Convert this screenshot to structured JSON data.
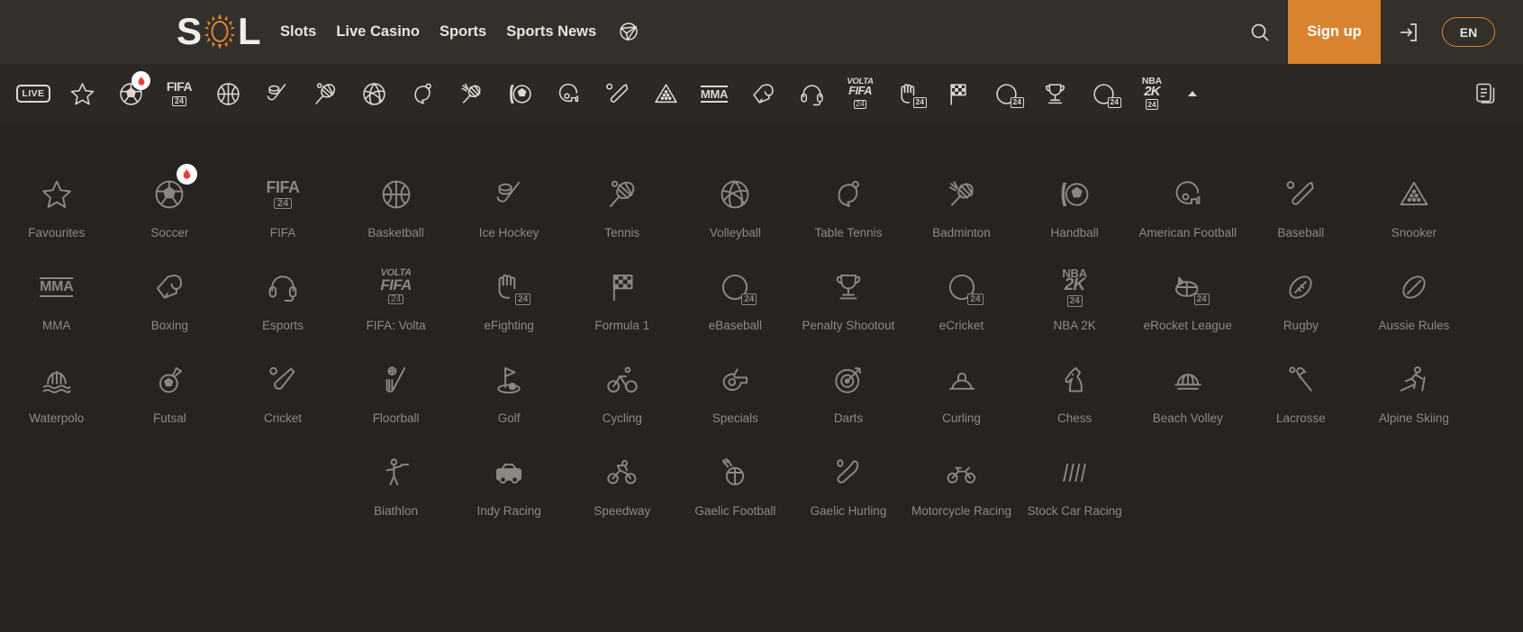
{
  "colors": {
    "page_bg": "#262320",
    "header_bg": "#332f2b",
    "toolbar_bg": "#2b2825",
    "accent_orange": "#d9832f",
    "icon_bright": "#ddd8cf",
    "icon_dim": "#8b8781",
    "label_text": "#8e8a84",
    "badge_flame_red": "#ef3b33"
  },
  "header": {
    "logo": {
      "text": "SOL",
      "letters": [
        "S",
        "O",
        "L"
      ],
      "icon": "sun-logo-icon"
    },
    "nav": [
      {
        "label": "Slots",
        "name": "nav-slots"
      },
      {
        "label": "Live Casino",
        "name": "nav-live-casino"
      },
      {
        "label": "Sports",
        "name": "nav-sports"
      },
      {
        "label": "Sports News",
        "name": "nav-sports-news"
      }
    ],
    "sports_news_icon": "paper-plane-globe-icon",
    "search_icon": "search-icon",
    "signup_label": "Sign up",
    "login_icon": "login-arrow-icon",
    "language_label": "EN"
  },
  "toolbar": {
    "collapse_icon": "chevron-up-icon",
    "bet_slip_icon": "bet-slip-documents-icon",
    "items": [
      {
        "name": "toolbar-live",
        "icon": "live-chip",
        "label": "LIVE"
      },
      {
        "name": "toolbar-favourites",
        "icon": "star-icon"
      },
      {
        "name": "toolbar-soccer",
        "icon": "soccer-ball-icon",
        "badge": "flame"
      },
      {
        "name": "toolbar-fifa",
        "icon": "fifa-24-badge",
        "label": "FIFA",
        "sub": "24"
      },
      {
        "name": "toolbar-basketball",
        "icon": "basketball-icon"
      },
      {
        "name": "toolbar-ice-hockey",
        "icon": "ice-hockey-icon"
      },
      {
        "name": "toolbar-tennis",
        "icon": "tennis-racket-icon"
      },
      {
        "name": "toolbar-volleyball",
        "icon": "volleyball-icon"
      },
      {
        "name": "toolbar-table-tennis",
        "icon": "table-tennis-icon"
      },
      {
        "name": "toolbar-badminton",
        "icon": "badminton-icon"
      },
      {
        "name": "toolbar-handball",
        "icon": "handball-icon"
      },
      {
        "name": "toolbar-american-football",
        "icon": "american-football-helmet-icon"
      },
      {
        "name": "toolbar-baseball",
        "icon": "baseball-bat-icon"
      },
      {
        "name": "toolbar-snooker",
        "icon": "snooker-triangle-icon"
      },
      {
        "name": "toolbar-mma",
        "icon": "mma-badge",
        "label": "MMA"
      },
      {
        "name": "toolbar-boxing",
        "icon": "boxing-glove-icon"
      },
      {
        "name": "toolbar-esports",
        "icon": "headset-icon"
      },
      {
        "name": "toolbar-fifa-volta",
        "icon": "volta-fifa-24-badge",
        "label": "VOLTA FIFA",
        "sub": "24"
      },
      {
        "name": "toolbar-efighting",
        "icon": "efighting-fist-icon",
        "sub": "24"
      },
      {
        "name": "toolbar-formula-1",
        "icon": "checkered-flag-icon"
      },
      {
        "name": "toolbar-ebaseball",
        "icon": "ebaseball-bat-icon",
        "sub": "24"
      },
      {
        "name": "toolbar-penalty-shootout",
        "icon": "trophy-icon"
      },
      {
        "name": "toolbar-ecricket",
        "icon": "ecricket-bat-icon",
        "sub": "24"
      },
      {
        "name": "toolbar-nba-2k",
        "icon": "nba-2k-24-badge",
        "label": "NBA 2K",
        "sub": "24"
      }
    ]
  },
  "grid": {
    "rows": [
      [
        {
          "label": "Favourites",
          "name": "sport-favourites",
          "icon": "star-icon"
        },
        {
          "label": "Soccer",
          "name": "sport-soccer",
          "icon": "soccer-ball-icon",
          "badge": "flame"
        },
        {
          "label": "FIFA",
          "name": "sport-fifa",
          "icon": "fifa-24-badge",
          "text": "FIFA",
          "sub": "24"
        },
        {
          "label": "Basketball",
          "name": "sport-basketball",
          "icon": "basketball-icon"
        },
        {
          "label": "Ice Hockey",
          "name": "sport-ice-hockey",
          "icon": "ice-hockey-icon"
        },
        {
          "label": "Tennis",
          "name": "sport-tennis",
          "icon": "tennis-racket-icon"
        },
        {
          "label": "Volleyball",
          "name": "sport-volleyball",
          "icon": "volleyball-icon"
        },
        {
          "label": "Table Tennis",
          "name": "sport-table-tennis",
          "icon": "table-tennis-icon"
        },
        {
          "label": "Badminton",
          "name": "sport-badminton",
          "icon": "badminton-icon"
        },
        {
          "label": "Handball",
          "name": "sport-handball",
          "icon": "handball-icon"
        },
        {
          "label": "American Football",
          "name": "sport-american-football",
          "icon": "american-football-helmet-icon"
        },
        {
          "label": "Baseball",
          "name": "sport-baseball",
          "icon": "baseball-bat-icon"
        },
        {
          "label": "Snooker",
          "name": "sport-snooker",
          "icon": "snooker-triangle-icon"
        }
      ],
      [
        {
          "label": "MMA",
          "name": "sport-mma",
          "icon": "mma-badge",
          "text": "MMA"
        },
        {
          "label": "Boxing",
          "name": "sport-boxing",
          "icon": "boxing-glove-icon"
        },
        {
          "label": "Esports",
          "name": "sport-esports",
          "icon": "headset-icon"
        },
        {
          "label": "FIFA: Volta",
          "name": "sport-fifa-volta",
          "icon": "volta-fifa-24-badge",
          "text": "VOLTA FIFA",
          "sub": "24"
        },
        {
          "label": "eFighting",
          "name": "sport-efighting",
          "icon": "efighting-fist-icon",
          "sub": "24"
        },
        {
          "label": "Formula 1",
          "name": "sport-formula-1",
          "icon": "checkered-flag-icon"
        },
        {
          "label": "eBaseball",
          "name": "sport-ebaseball",
          "icon": "ebaseball-bat-icon",
          "sub": "24"
        },
        {
          "label": "Penalty Shootout",
          "name": "sport-penalty-shootout",
          "icon": "trophy-icon"
        },
        {
          "label": "eCricket",
          "name": "sport-ecricket",
          "icon": "ecricket-bat-icon",
          "sub": "24"
        },
        {
          "label": "NBA 2K",
          "name": "sport-nba-2k",
          "icon": "nba-2k-24-badge",
          "text": "NBA 2K",
          "sub": "24"
        },
        {
          "label": "eRocket League",
          "name": "sport-erocket-league",
          "icon": "erocket-league-icon",
          "sub": "24"
        },
        {
          "label": "Rugby",
          "name": "sport-rugby",
          "icon": "rugby-ball-icon"
        },
        {
          "label": "Aussie Rules",
          "name": "sport-aussie-rules",
          "icon": "aussie-rules-ball-icon"
        }
      ],
      [
        {
          "label": "Waterpolo",
          "name": "sport-waterpolo",
          "icon": "waterpolo-icon"
        },
        {
          "label": "Futsal",
          "name": "sport-futsal",
          "icon": "futsal-icon"
        },
        {
          "label": "Cricket",
          "name": "sport-cricket",
          "icon": "cricket-bat-icon"
        },
        {
          "label": "Floorball",
          "name": "sport-floorball",
          "icon": "floorball-stick-icon"
        },
        {
          "label": "Golf",
          "name": "sport-golf",
          "icon": "golf-flag-icon"
        },
        {
          "label": "Cycling",
          "name": "sport-cycling",
          "icon": "cycling-icon"
        },
        {
          "label": "Specials",
          "name": "sport-specials",
          "icon": "specials-whistle-icon"
        },
        {
          "label": "Darts",
          "name": "sport-darts",
          "icon": "darts-icon"
        },
        {
          "label": "Curling",
          "name": "sport-curling",
          "icon": "curling-stone-icon"
        },
        {
          "label": "Chess",
          "name": "sport-chess",
          "icon": "chess-knight-icon"
        },
        {
          "label": "Beach Volley",
          "name": "sport-beach-volley",
          "icon": "beach-volley-icon"
        },
        {
          "label": "Lacrosse",
          "name": "sport-lacrosse",
          "icon": "lacrosse-stick-icon"
        },
        {
          "label": "Alpine Skiing",
          "name": "sport-alpine-skiing",
          "icon": "alpine-skiing-icon"
        }
      ],
      [
        {
          "empty": true
        },
        {
          "empty": true
        },
        {
          "empty": true
        },
        {
          "label": "Biathlon",
          "name": "sport-biathlon",
          "icon": "biathlon-icon"
        },
        {
          "label": "Indy Racing",
          "name": "sport-indy-racing",
          "icon": "indy-racing-car-icon"
        },
        {
          "label": "Speedway",
          "name": "sport-speedway",
          "icon": "speedway-motorcycle-icon"
        },
        {
          "label": "Gaelic Football",
          "name": "sport-gaelic-football",
          "icon": "gaelic-football-icon"
        },
        {
          "label": "Gaelic Hurling",
          "name": "sport-gaelic-hurling",
          "icon": "gaelic-hurling-icon"
        },
        {
          "label": "Motorcycle Racing",
          "name": "sport-motorcycle-racing",
          "icon": "motorcycle-racing-icon"
        },
        {
          "label": "Stock Car Racing",
          "name": "sport-stock-car-racing",
          "icon": "stock-car-racing-icon"
        },
        {
          "empty": true
        },
        {
          "empty": true
        },
        {
          "empty": true
        }
      ]
    ]
  }
}
